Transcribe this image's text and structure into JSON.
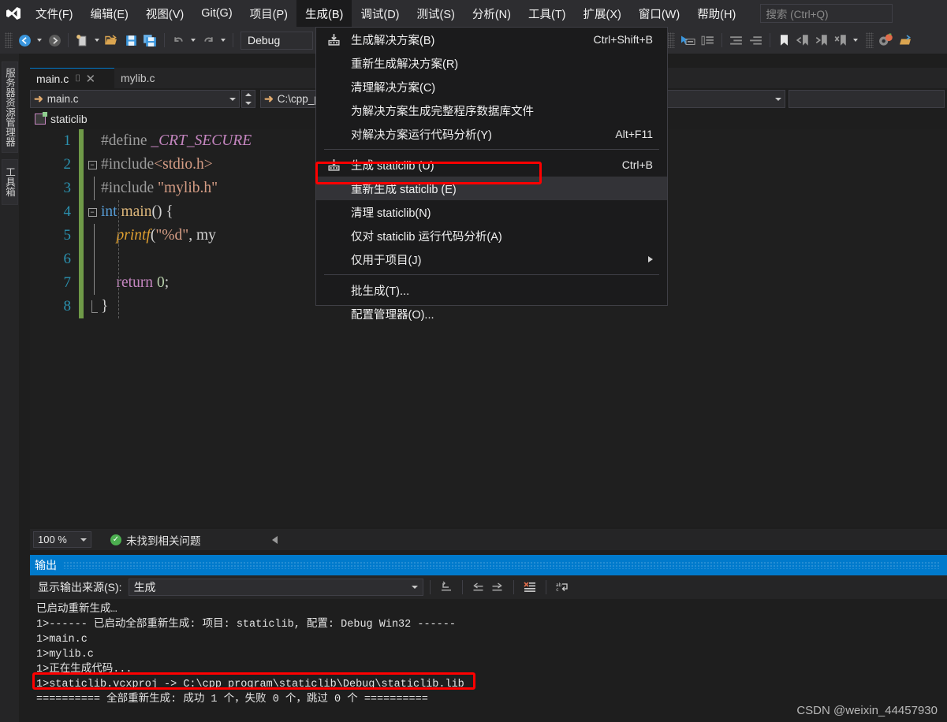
{
  "app": {
    "logo_icon": "visual-studio-logo"
  },
  "menubar": {
    "items": [
      {
        "label": "文件(F)",
        "active": false
      },
      {
        "label": "编辑(E)",
        "active": false
      },
      {
        "label": "视图(V)",
        "active": false
      },
      {
        "label": "Git(G)",
        "active": false
      },
      {
        "label": "项目(P)",
        "active": false
      },
      {
        "label": "生成(B)",
        "active": true
      },
      {
        "label": "调试(D)",
        "active": false
      },
      {
        "label": "测试(S)",
        "active": false
      },
      {
        "label": "分析(N)",
        "active": false
      },
      {
        "label": "工具(T)",
        "active": false
      },
      {
        "label": "扩展(X)",
        "active": false
      },
      {
        "label": "窗口(W)",
        "active": false
      },
      {
        "label": "帮助(H)",
        "active": false
      }
    ],
    "search_placeholder": "搜索 (Ctrl+Q)"
  },
  "toolbar": {
    "config_value": "Debug",
    "icons": [
      "navigate-back-icon",
      "navigate-forward-icon",
      "new-item-icon",
      "open-file-icon",
      "save-icon",
      "save-all-icon",
      "undo-icon",
      "redo-icon"
    ],
    "right_icons": [
      "home-icon",
      "pointer-select-icon",
      "comment-icon",
      "indent-icon",
      "outdent-icon",
      "bookmark-icon",
      "prev-bookmark-icon",
      "next-bookmark-icon",
      "clear-bookmarks-icon",
      "settings-icon",
      "open-folder-icon"
    ]
  },
  "left_rail": {
    "tabs": [
      {
        "label": "服务器资源管理器",
        "name": "server-explorer"
      },
      {
        "label": "工具箱",
        "name": "toolbox"
      }
    ]
  },
  "editor": {
    "tabs": [
      {
        "label": "main.c",
        "selected": true,
        "pin_icon": "pin-icon",
        "close_icon": "close-icon"
      },
      {
        "label": "mylib.c",
        "selected": false
      }
    ],
    "nav_left_value": "main.c",
    "nav_right_value": "C:\\cpp_pro",
    "project_label": "staticlib",
    "zoom_level": "100 %",
    "status_text": "未找到相关问题",
    "status_icon": "check-circle-icon",
    "code_lines": [
      {
        "num": "1",
        "tokens": [
          {
            "t": "#define ",
            "c": "c-pre"
          },
          {
            "t": "_CRT_SECURE",
            "c": "c-macro"
          }
        ]
      },
      {
        "num": "2",
        "tokens": [
          {
            "t": "#include",
            "c": "c-pre"
          },
          {
            "t": "<stdio.h>",
            "c": "c-hdr"
          }
        ]
      },
      {
        "num": "3",
        "tokens": [
          {
            "t": "#include ",
            "c": "c-pre"
          },
          {
            "t": "\"mylib.h\"",
            "c": "c-hdr"
          }
        ]
      },
      {
        "num": "4",
        "tokens": [
          {
            "t": "int",
            "c": "c-kw"
          },
          {
            "t": " ",
            "c": "c-plain"
          },
          {
            "t": "main",
            "c": "c-fn"
          },
          {
            "t": "() {",
            "c": "c-plain"
          }
        ]
      },
      {
        "num": "5",
        "tokens": [
          {
            "t": "    ",
            "c": "c-plain"
          },
          {
            "t": "printf",
            "c": "c-fn-it"
          },
          {
            "t": "(",
            "c": "c-plain"
          },
          {
            "t": "\"%d\"",
            "c": "c-str"
          },
          {
            "t": ", my",
            "c": "c-plain"
          }
        ]
      },
      {
        "num": "6",
        "tokens": []
      },
      {
        "num": "7",
        "tokens": [
          {
            "t": "    ",
            "c": "c-plain"
          },
          {
            "t": "return",
            "c": "c-kw2"
          },
          {
            "t": " ",
            "c": "c-plain"
          },
          {
            "t": "0",
            "c": "c-num"
          },
          {
            "t": ";",
            "c": "c-plain"
          }
        ]
      },
      {
        "num": "8",
        "tokens": [
          {
            "t": "}",
            "c": "c-plain"
          }
        ]
      }
    ]
  },
  "build_menu": {
    "items": [
      {
        "label": "生成解决方案(B)",
        "shortcut": "Ctrl+Shift+B",
        "icon": "build-icon",
        "highlight": false,
        "submenu": false,
        "sep_after": false
      },
      {
        "label": "重新生成解决方案(R)",
        "shortcut": "",
        "icon": "",
        "highlight": false,
        "submenu": false,
        "sep_after": false
      },
      {
        "label": "清理解决方案(C)",
        "shortcut": "",
        "icon": "",
        "highlight": false,
        "submenu": false,
        "sep_after": false
      },
      {
        "label": "为解决方案生成完整程序数据库文件",
        "shortcut": "",
        "icon": "",
        "highlight": false,
        "submenu": false,
        "sep_after": false
      },
      {
        "label": "对解决方案运行代码分析(Y)",
        "shortcut": "Alt+F11",
        "icon": "",
        "highlight": false,
        "submenu": false,
        "sep_after": true
      },
      {
        "label": "生成 staticlib (U)",
        "shortcut": "Ctrl+B",
        "icon": "build-icon",
        "highlight": false,
        "submenu": false,
        "sep_after": false
      },
      {
        "label": "重新生成 staticlib (E)",
        "shortcut": "",
        "icon": "",
        "highlight": true,
        "submenu": false,
        "sep_after": false
      },
      {
        "label": "清理 staticlib(N)",
        "shortcut": "",
        "icon": "",
        "highlight": false,
        "submenu": false,
        "sep_after": false
      },
      {
        "label": "仅对 staticlib 运行代码分析(A)",
        "shortcut": "",
        "icon": "",
        "highlight": false,
        "submenu": false,
        "sep_after": false
      },
      {
        "label": "仅用于项目(J)",
        "shortcut": "",
        "icon": "",
        "highlight": false,
        "submenu": true,
        "sep_after": true
      },
      {
        "label": "批生成(T)...",
        "shortcut": "",
        "icon": "",
        "highlight": false,
        "submenu": false,
        "sep_after": false
      },
      {
        "label": "配置管理器(O)...",
        "shortcut": "",
        "icon": "",
        "highlight": false,
        "submenu": false,
        "sep_after": false
      }
    ]
  },
  "output": {
    "title": "输出",
    "source_label": "显示输出来源(S):",
    "source_value": "生成",
    "toolbar_icons": [
      "jump-to-icon",
      "previous-message-icon",
      "next-message-icon",
      "clear-output-icon",
      "word-wrap-icon"
    ],
    "lines": [
      "已启动重新生成…",
      "1>------ 已启动全部重新生成: 项目: staticlib, 配置: Debug Win32 ------",
      "1>main.c",
      "1>mylib.c",
      "1>正在生成代码...",
      "1>staticlib.vcxproj -> C:\\cpp program\\staticlib\\Debug\\staticlib.lib",
      "========== 全部重新生成: 成功 1 个，失败 0 个，跳过 0 个 =========="
    ]
  },
  "watermark": "CSDN @weixin_44457930",
  "colors": {
    "accent": "#007acc",
    "menu_bg": "#2d2d30",
    "editor_bg": "#1f1f1f",
    "highlight_rect": "#ff0000"
  }
}
